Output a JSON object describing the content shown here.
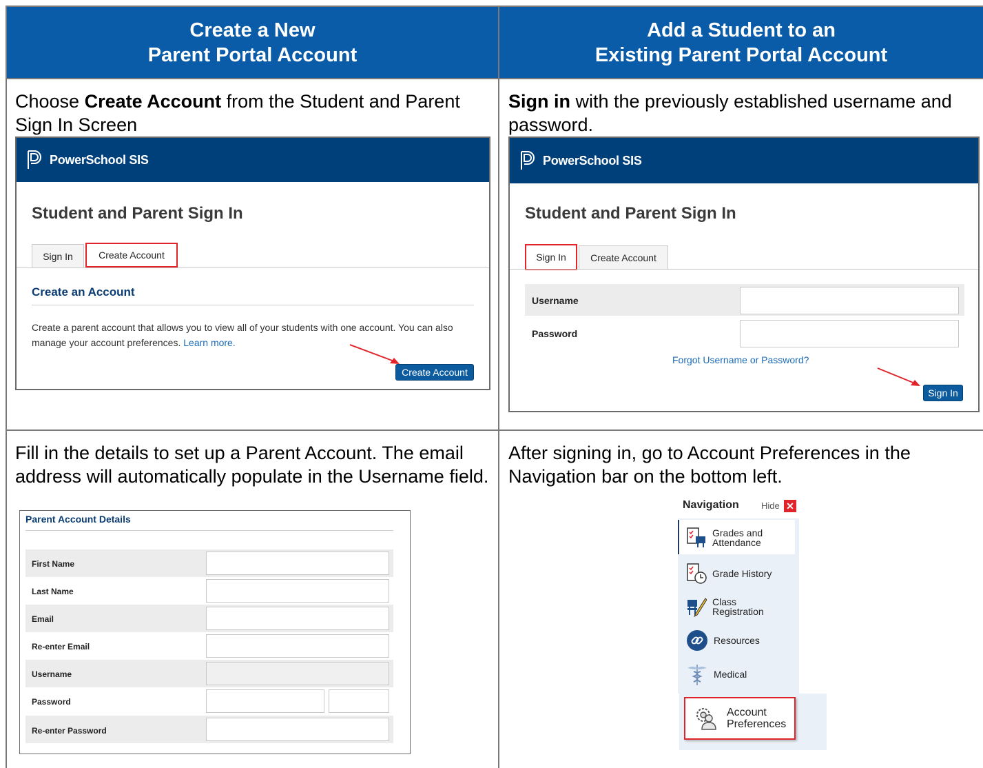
{
  "headers": {
    "left_line1": "Create a New",
    "left_line2": "Parent Portal Account",
    "right_line1": "Add a Student to an",
    "right_line2": "Existing Parent Portal Account"
  },
  "step1": {
    "pre": "Choose ",
    "bold": "Create Account",
    "post": " from the Student and Parent Sign In Screen"
  },
  "step2": {
    "bold": "Sign in",
    "post": " with the previously established username and password."
  },
  "step3": {
    "text": "Fill in the details to set up a Parent Account. The email address will automatically populate in the Username field."
  },
  "step4": {
    "text": "After signing in, go to Account Preferences in the Navigation bar on the bottom left."
  },
  "powerschool": {
    "logo_text": "PowerSchool SIS",
    "page_title": "Student and Parent Sign In",
    "tab_sign_in": "Sign In",
    "tab_create_account": "Create Account"
  },
  "create_panel": {
    "section_title": "Create an Account",
    "body": "Create a parent account that allows you to view all of your students with one account. You can also manage your account preferences. ",
    "learn_more": "Learn more.",
    "button": "Create Account"
  },
  "signin_panel": {
    "username_label": "Username",
    "password_label": "Password",
    "forgot_link": "Forgot Username or Password?",
    "button": "Sign In"
  },
  "account_details": {
    "title": "Parent Account Details",
    "fields": [
      "First Name",
      "Last Name",
      "Email",
      "Re-enter Email",
      "Username",
      "Password",
      "Re-enter Password"
    ]
  },
  "navigation": {
    "title": "Navigation",
    "hide": "Hide",
    "items": [
      {
        "line1": "Grades and",
        "line2": "Attendance"
      },
      {
        "line1": "Grade History",
        "line2": ""
      },
      {
        "line1": "Class",
        "line2": "Registration"
      },
      {
        "line1": "Resources",
        "line2": ""
      },
      {
        "line1": "Medical",
        "line2": ""
      }
    ],
    "account_pref_line1": "Account",
    "account_pref_line2": "Preferences"
  },
  "colors": {
    "header_blue": "#0a5ba8",
    "ps_navy": "#00407a",
    "button_blue": "#0b5b9e",
    "highlight_red": "#e0242a"
  }
}
